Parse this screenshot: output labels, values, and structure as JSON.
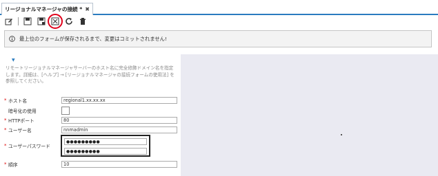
{
  "tab": {
    "title": "リージョナルマネージャの接続 *",
    "close_glyph": "✖"
  },
  "toolbar": {
    "buttons": [
      {
        "name": "edit-icon"
      },
      {
        "name": "save-icon"
      },
      {
        "name": "save-and-close-icon"
      },
      {
        "name": "save-and-new-icon"
      },
      {
        "name": "refresh-icon"
      },
      {
        "name": "delete-icon"
      }
    ],
    "highlight_color": "#e0001a"
  },
  "notice": {
    "icon": "info-icon",
    "text": "最上位のフォームが保存されるまで、変更はコミットされません!"
  },
  "form": {
    "description": "リモートリージョナルマネージャサーバーのホスト名に完全修飾ドメイン名を指定します。詳細は、[ヘルプ] → [リージョナルマネージャの接続フォームの使用法] を参照してください。",
    "fields": {
      "hostname": {
        "label": "ホスト名",
        "required": true,
        "value": "regional1.xx.xx.xx"
      },
      "encryption": {
        "label": "暗号化の使用",
        "required": false,
        "checked": false
      },
      "http_port": {
        "label": "HTTPポート",
        "required": true,
        "value": "80"
      },
      "username": {
        "label": "ユーザー名",
        "required": true,
        "value": "nnmadmin"
      },
      "password": {
        "label": "ユーザーパスワード",
        "required": true,
        "value": "●●●●●●●●●",
        "confirm_value": "●●●●●●●●●"
      },
      "order": {
        "label": "順序",
        "required": true,
        "value": "10"
      }
    },
    "required_marker": "*"
  },
  "colors": {
    "accent": "#2a7bbf",
    "right_panel": "#eaeaf2"
  }
}
